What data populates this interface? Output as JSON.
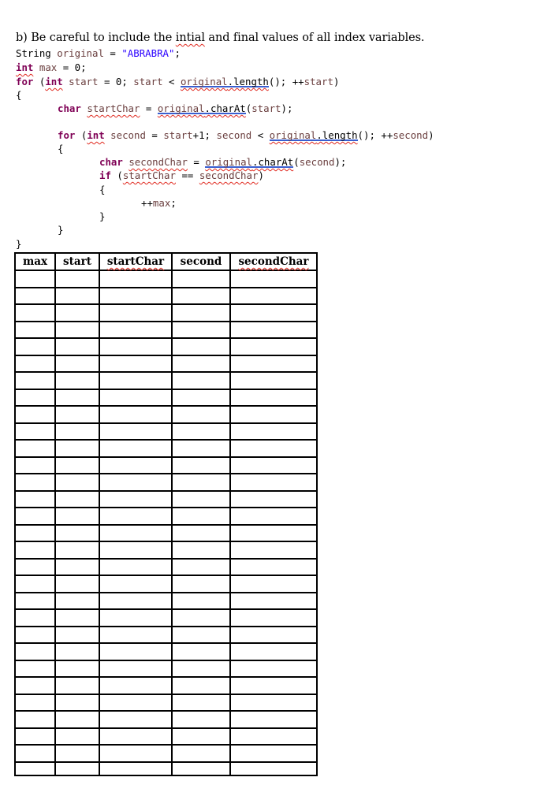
{
  "instruction": "b) Be careful to include the intial and final values of all index variables.",
  "code": {
    "line1": {
      "type": "String",
      "name": "original",
      "op": " = ",
      "literal": "\"ABRABRA\"",
      "end": ";"
    },
    "line2": {
      "type": "int",
      "name": "max",
      "rest": " = 0;"
    },
    "line3": {
      "kw": "for",
      "open": " (",
      "type": "int",
      "var": "start",
      "mid": " = 0; ",
      "var2": "start",
      "lt": " < ",
      "obj": "original",
      "method": ".length",
      "call": "(); ++",
      "var3": "start",
      "close": ")"
    },
    "line4": "{",
    "line5": {
      "type": "char",
      "name": "startChar",
      "op": " = ",
      "obj": "original",
      "method": ".charAt",
      "open": "(",
      "arg": "start",
      "close": ");"
    },
    "line6": {
      "kw": "for",
      "open": " (",
      "type": "int",
      "var": "second",
      "mid": " = ",
      "var2": "start",
      "plus": "+1; ",
      "var3": "second",
      "lt": " < ",
      "obj": "original",
      "method": ".length",
      "call": "(); ++",
      "var4": "second",
      "close": ")"
    },
    "line7": "{",
    "line8": {
      "type": "char",
      "name": "secondChar",
      "op": " = ",
      "obj": "original",
      "method": ".charAt",
      "open": "(",
      "arg": "second",
      "close": ");"
    },
    "line9": {
      "kw": "if",
      "open": " (",
      "a": "startChar",
      "op": " == ",
      "b": "secondChar",
      "close": ")"
    },
    "line10": "{",
    "line11": {
      "pre": "++",
      "var": "max",
      "end": ";"
    },
    "line12": "}",
    "line13": "}",
    "line14": "}"
  },
  "table": {
    "headers": [
      "max",
      "start",
      "startChar",
      "second",
      "secondChar"
    ],
    "row_count": 30
  }
}
